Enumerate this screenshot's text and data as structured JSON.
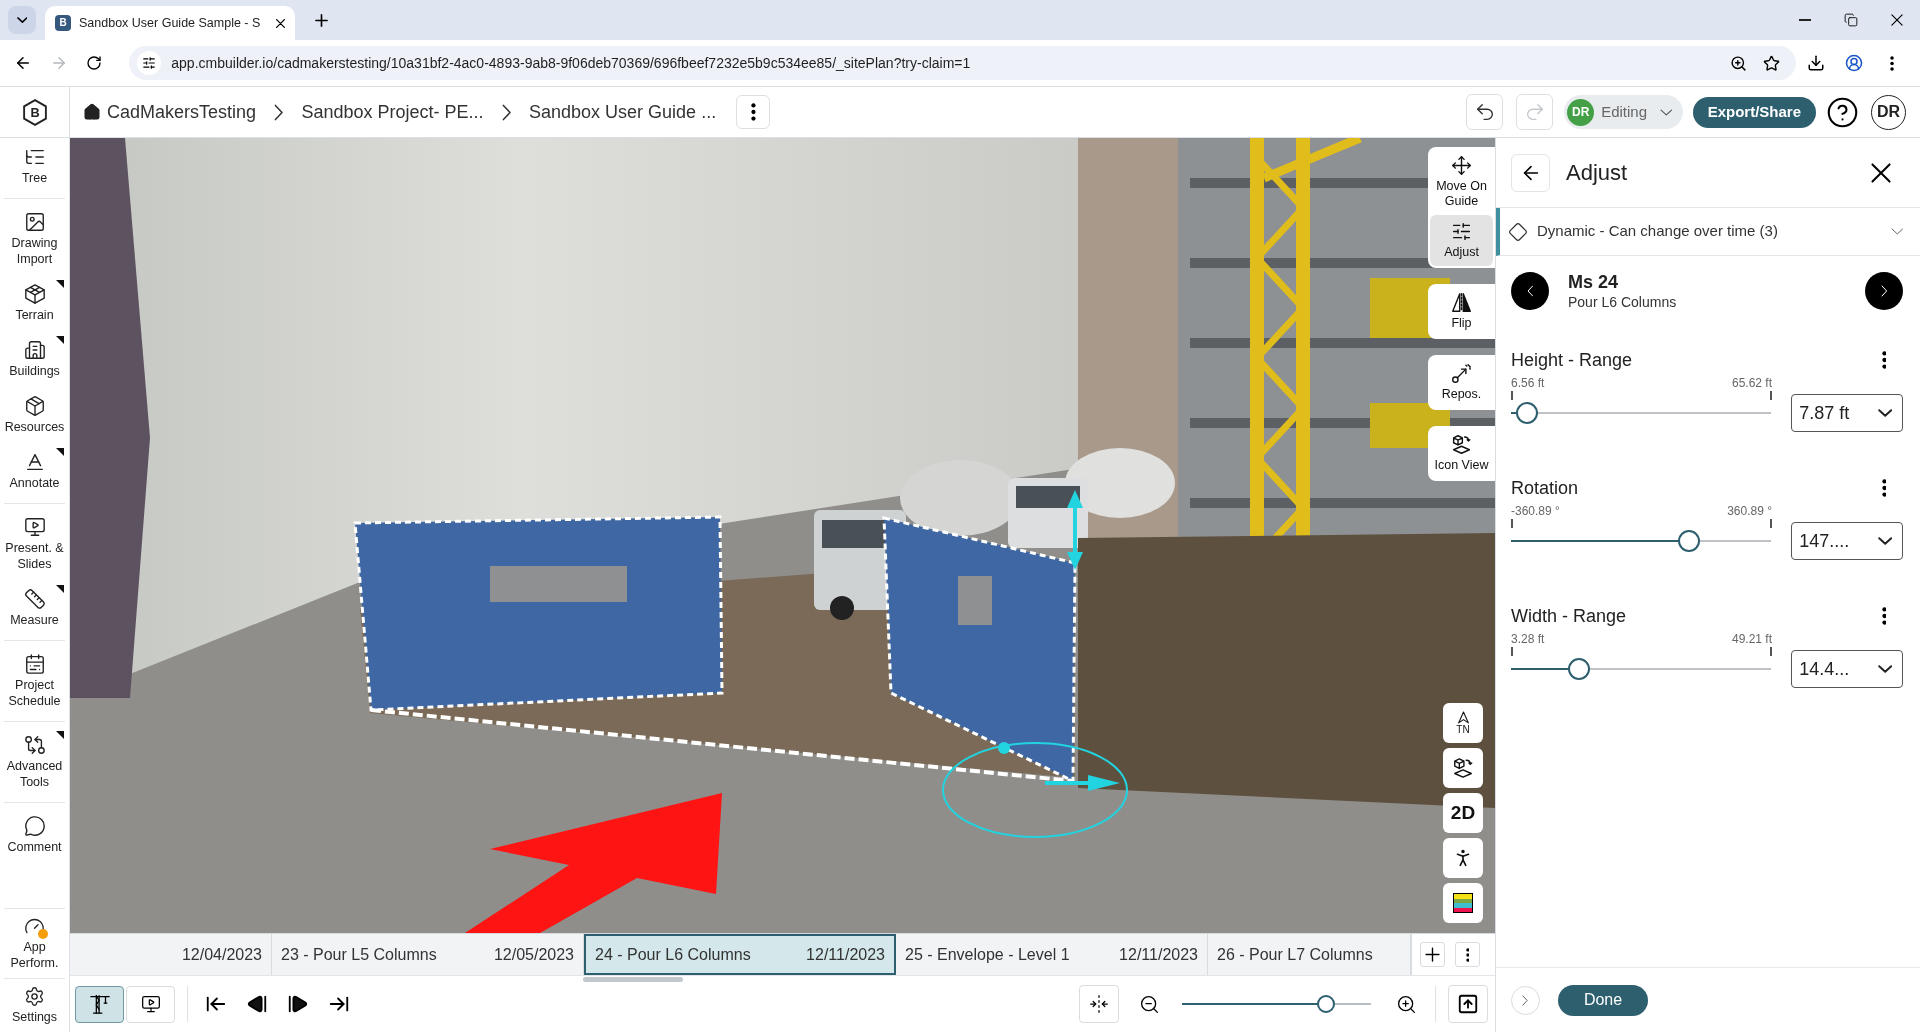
{
  "browser": {
    "tab": {
      "favicon": "B",
      "title": "Sandbox User Guide Sample - S"
    },
    "url": "app.cmbuilder.io/cadmakerstesting/10a31bf2-4ac0-4893-9ab8-9f06deb70369/696fbeef7232e5b9c534ee85/_sitePlan?try-claim=1"
  },
  "header": {
    "logo": "B",
    "breadcrumbs": [
      "CadMakersTesting",
      "Sandbox Project- PE...",
      "Sandbox User Guide ..."
    ],
    "undo": {
      "disabled": false
    },
    "redo": {
      "disabled": true
    },
    "mode": {
      "avatar": "DR",
      "label": "Editing"
    },
    "export": "Export/Share",
    "user": "DR"
  },
  "sidebar": {
    "items": [
      {
        "label": "Tree",
        "submenu": false
      },
      {
        "label": "Drawing Import",
        "submenu": false
      },
      {
        "label": "Terrain",
        "submenu": true
      },
      {
        "label": "Buildings",
        "submenu": true
      },
      {
        "label": "Resources",
        "submenu": false
      },
      {
        "label": "Annotate",
        "submenu": true
      },
      {
        "label": "Present. & Slides",
        "submenu": false
      },
      {
        "label": "Measure",
        "submenu": true
      },
      {
        "label": "Project Schedule",
        "submenu": false
      },
      {
        "label": "Advanced Tools",
        "submenu": true
      },
      {
        "label": "Comment",
        "submenu": false
      }
    ],
    "bottom_items": [
      {
        "label": "App Perform.",
        "alert": true
      },
      {
        "label": "Settings",
        "alert": false
      }
    ]
  },
  "viewport_tools": {
    "groups": [
      {
        "tools": [
          {
            "label": "Move On Guide",
            "selected": false
          },
          {
            "label": "Adjust",
            "selected": true
          }
        ]
      },
      {
        "tools": [
          {
            "label": "Flip",
            "selected": false
          }
        ]
      },
      {
        "tools": [
          {
            "label": "Repos.",
            "selected": false
          }
        ]
      },
      {
        "tools": [
          {
            "label": "Icon View",
            "selected": false
          }
        ]
      }
    ]
  },
  "view_tools": [
    {
      "kind": "north",
      "label": "TN"
    },
    {
      "kind": "view_switch"
    },
    {
      "kind": "text",
      "label": "2D"
    },
    {
      "kind": "walk"
    },
    {
      "kind": "layers"
    }
  ],
  "timeline": {
    "milestones": [
      {
        "date": "12/04/2023",
        "selected": false
      },
      {
        "label": "23 - Pour L5 Columns",
        "date": "12/05/2023",
        "selected": false
      },
      {
        "label": "24 - Pour L6 Columns",
        "date": "12/11/2023",
        "selected": true
      },
      {
        "label": "25 - Envelope - Level 1",
        "date": "12/11/2023",
        "selected": false
      },
      {
        "label": "26 - Pour L7 Columns",
        "selected": false
      }
    ]
  },
  "playback": {
    "modes": [
      {
        "selected": true
      },
      {
        "selected": false
      }
    ],
    "zoom": {
      "level": 0.79
    }
  },
  "panel": {
    "title": "Adjust",
    "category": "Dynamic - Can change over time (3)",
    "milestone": {
      "title": "Ms 24",
      "subtitle": "Pour L6 Columns"
    },
    "controls": [
      {
        "title": "Height - Range",
        "min": "6.56 ft",
        "max": "65.62 ft",
        "level": 0.02,
        "value": "7.87 ft"
      },
      {
        "title": "Rotation",
        "min": "-360.89 °",
        "max": "360.89 °",
        "level": 0.7,
        "value": "147...."
      },
      {
        "title": "Width - Range",
        "min": "3.28 ft",
        "max": "49.21 ft",
        "level": 0.24,
        "value": "14.4..."
      }
    ],
    "done": "Done"
  }
}
